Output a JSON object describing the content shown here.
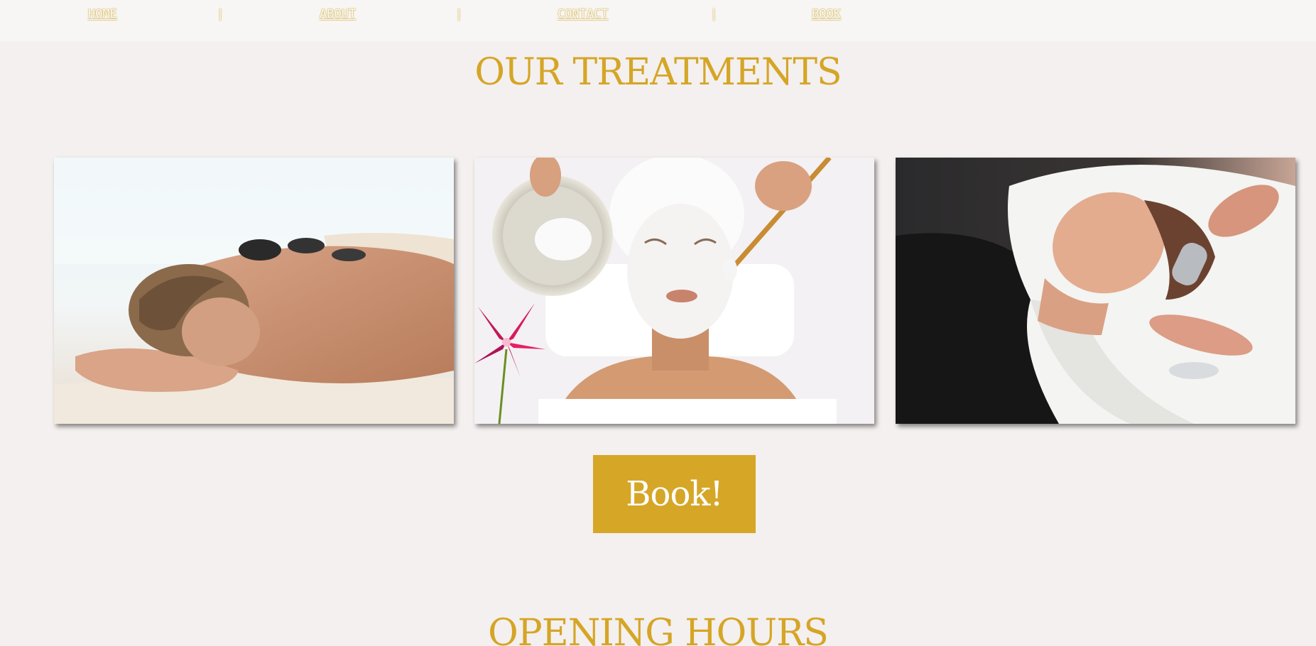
{
  "nav": {
    "home": "HOME",
    "about": "ABOUT",
    "contact": "CONTACT",
    "book": "BOOK",
    "separator": "|"
  },
  "treatments": {
    "title": "OUR TREATMENTS"
  },
  "book_button": {
    "label": "Book!"
  },
  "opening_hours": {
    "title": "OPENING HOURS"
  },
  "colors": {
    "accent": "#d6a627",
    "background": "#f4f0ef",
    "nav_background": "#f8f6f5"
  }
}
